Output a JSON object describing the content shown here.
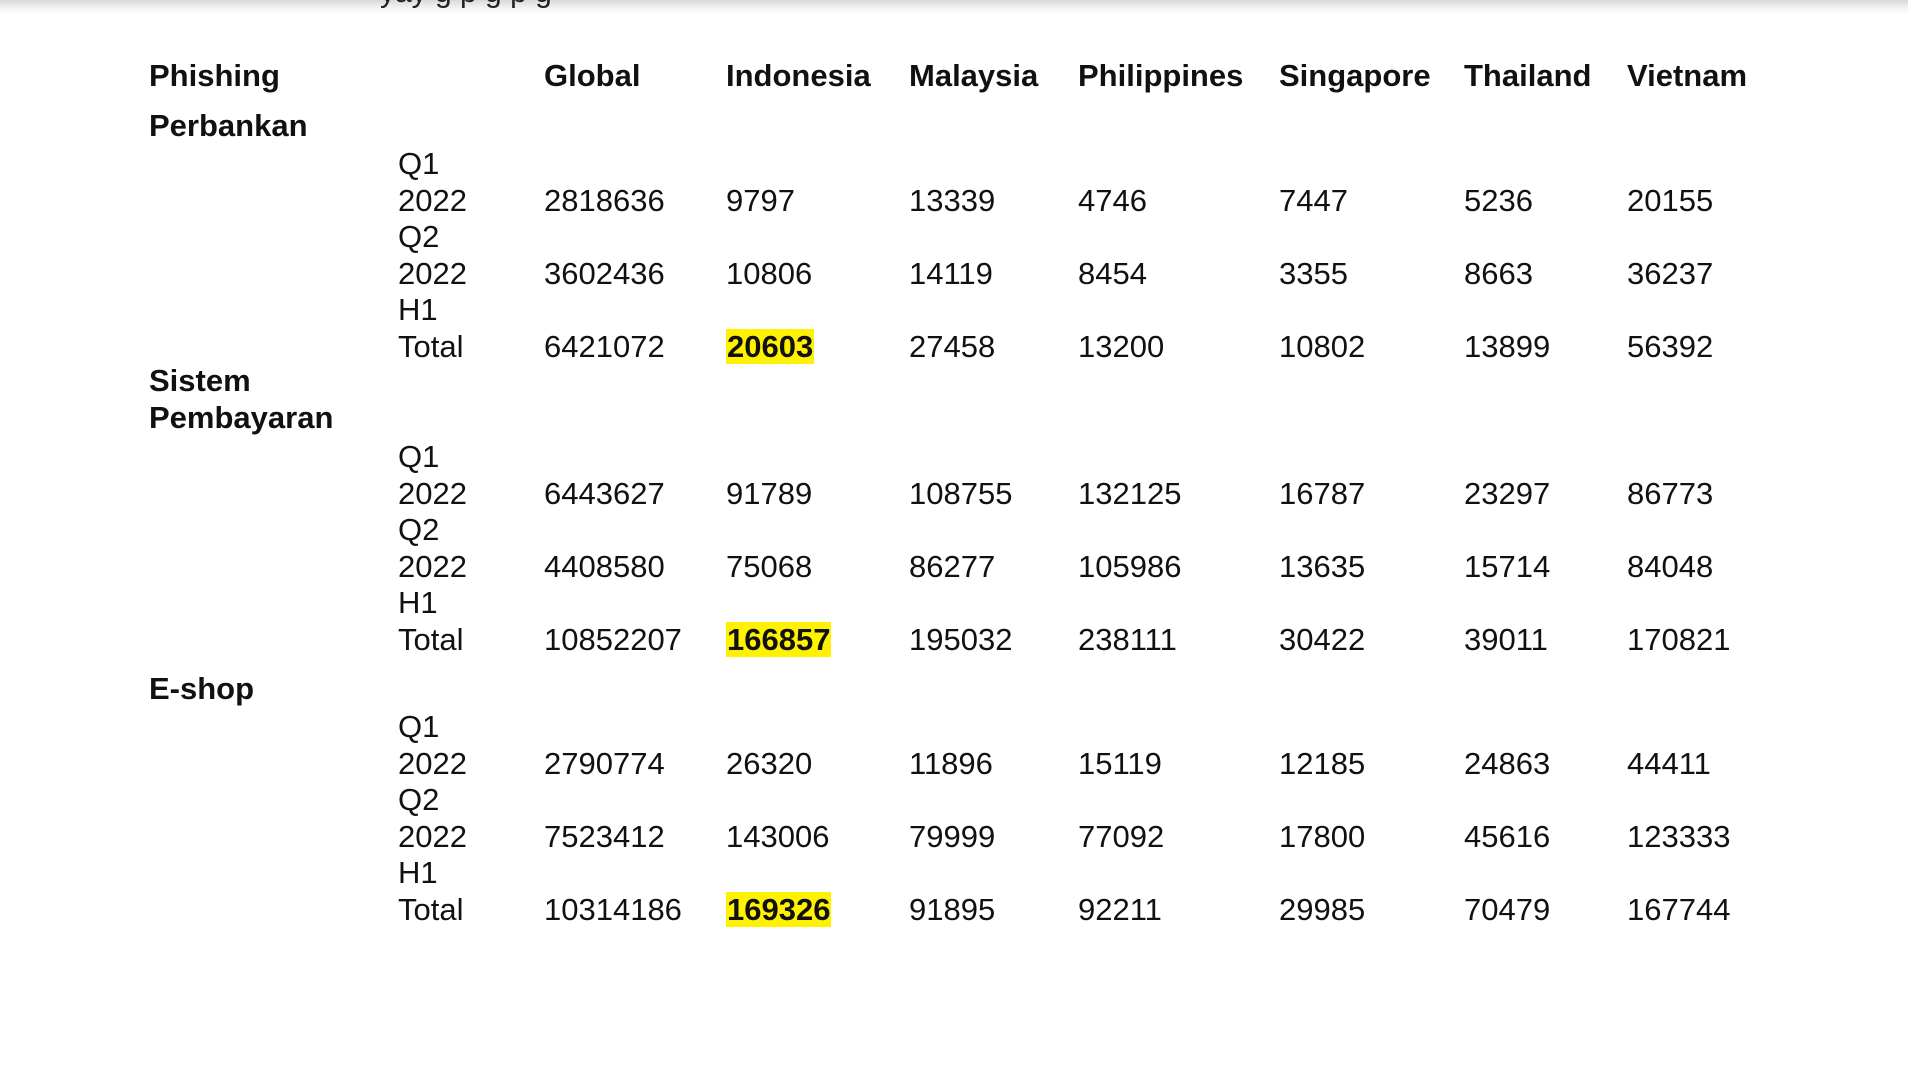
{
  "doc": {
    "top_text": "         yay     g p  g                                              p           g"
  },
  "table": {
    "header": [
      "Phishing",
      "",
      "Global",
      "Indonesia",
      "Malaysia",
      "Philippines",
      "Singapore",
      "Thailand",
      "Vietnam"
    ],
    "sections": [
      {
        "category": "Perbankan",
        "rows": [
          {
            "period": [
              "Q1",
              "2022"
            ],
            "values": [
              "2818636",
              "9797",
              "13339",
              "4746",
              "7447",
              "5236",
              "20155"
            ],
            "highlight_indonesia": false
          },
          {
            "period": [
              "Q2",
              "2022"
            ],
            "values": [
              "3602436",
              "10806",
              "14119",
              "8454",
              "3355",
              "8663",
              "36237"
            ],
            "highlight_indonesia": false
          },
          {
            "period": [
              "H1",
              "Total"
            ],
            "values": [
              "6421072",
              "20603",
              "27458",
              "13200",
              "10802",
              "13899",
              "56392"
            ],
            "highlight_indonesia": true
          }
        ]
      },
      {
        "category": "Sistem\nPembayaran",
        "rows": [
          {
            "period": [
              "Q1",
              "2022"
            ],
            "values": [
              "6443627",
              "91789",
              "108755",
              "132125",
              "16787",
              "23297",
              "86773"
            ],
            "highlight_indonesia": false
          },
          {
            "period": [
              "Q2",
              "2022"
            ],
            "values": [
              "4408580",
              "75068",
              "86277",
              "105986",
              "13635",
              "15714",
              "84048"
            ],
            "highlight_indonesia": false
          },
          {
            "period": [
              "H1",
              "Total"
            ],
            "values": [
              "10852207",
              "166857",
              "195032",
              "238111",
              "30422",
              "39011",
              "170821"
            ],
            "highlight_indonesia": true
          }
        ]
      },
      {
        "category": "E-shop",
        "rows": [
          {
            "period": [
              "Q1",
              "2022"
            ],
            "values": [
              "2790774",
              "26320",
              "11896",
              "15119",
              "12185",
              "24863",
              "44411"
            ],
            "highlight_indonesia": false
          },
          {
            "period": [
              "Q2",
              "2022"
            ],
            "values": [
              "7523412",
              "143006",
              "79999",
              "77092",
              "17800",
              "45616",
              "123333"
            ],
            "highlight_indonesia": false
          },
          {
            "period": [
              "H1",
              "Total"
            ],
            "values": [
              "10314186",
              "169326",
              "91895",
              "92211",
              "29985",
              "70479",
              "167744"
            ],
            "highlight_indonesia": true
          }
        ]
      }
    ]
  },
  "colors": {
    "highlight": "#fff200",
    "text": "#111111"
  }
}
